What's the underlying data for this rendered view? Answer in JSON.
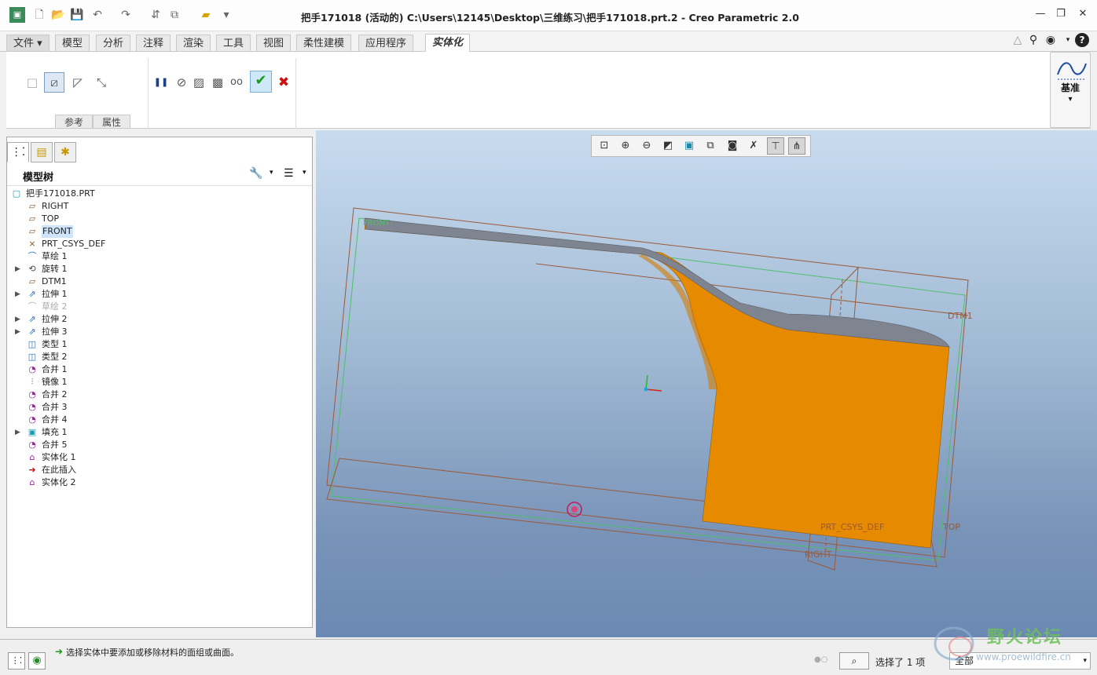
{
  "window": {
    "title": "把手171018 (活动的) C:\\Users\\12145\\Desktop\\三维练习\\把手171018.prt.2 - Creo Parametric 2.0",
    "minimize": "—",
    "restore": "❐",
    "close": "✕"
  },
  "quick_access": {
    "icons": [
      "app-icon",
      "new-file-icon",
      "open-file-icon",
      "save-icon",
      "undo-icon",
      "redo-icon",
      "regenerate-icon",
      "windows-icon",
      "folder-icon",
      "customize-icon"
    ]
  },
  "tabs": [
    "文件 ▾",
    "模型",
    "分析",
    "注释",
    "渲染",
    "工具",
    "视图",
    "柔性建模",
    "应用程序",
    "实体化"
  ],
  "active_tab": "实体化",
  "ribbon": {
    "group_labels": [
      "参考",
      "属性"
    ],
    "datum_label": "基准",
    "datum_arrow": "▾",
    "confirm_symbol": "✔",
    "cancel_symbol": "✖",
    "pause_symbol": "❚❚",
    "glasses_symbol": "oo",
    "help_symbol": "?"
  },
  "model_tree": {
    "title": "模型树",
    "items": [
      {
        "label": "把手171018.PRT",
        "icon": "part-icon",
        "expand": false,
        "indent": 0
      },
      {
        "label": "RIGHT",
        "icon": "plane-icon",
        "expand": false,
        "indent": 1
      },
      {
        "label": "TOP",
        "icon": "plane-icon",
        "expand": false,
        "indent": 1
      },
      {
        "label": "FRONT",
        "icon": "plane-icon",
        "expand": false,
        "indent": 1,
        "highlight": true
      },
      {
        "label": "PRT_CSYS_DEF",
        "icon": "csys-icon",
        "expand": false,
        "indent": 1
      },
      {
        "label": "草绘 1",
        "icon": "sketch-icon",
        "expand": false,
        "indent": 1
      },
      {
        "label": "旋转 1",
        "icon": "revolve-icon",
        "expand": true,
        "indent": 1
      },
      {
        "label": "DTM1",
        "icon": "plane-icon",
        "expand": false,
        "indent": 1
      },
      {
        "label": "拉伸 1",
        "icon": "extrude-icon",
        "expand": true,
        "indent": 1
      },
      {
        "label": "草绘 2",
        "icon": "sketch-icon",
        "expand": false,
        "indent": 1,
        "dim": true
      },
      {
        "label": "拉伸 2",
        "icon": "extrude-icon",
        "expand": true,
        "indent": 1
      },
      {
        "label": "拉伸 3",
        "icon": "extrude-icon",
        "expand": true,
        "indent": 1
      },
      {
        "label": "类型 1",
        "icon": "boundary-icon",
        "expand": false,
        "indent": 1
      },
      {
        "label": "类型 2",
        "icon": "boundary-icon",
        "expand": false,
        "indent": 1
      },
      {
        "label": "合并 1",
        "icon": "merge-icon",
        "expand": false,
        "indent": 1
      },
      {
        "label": "镜像 1",
        "icon": "mirror-icon",
        "expand": false,
        "indent": 1
      },
      {
        "label": "合并 2",
        "icon": "merge-icon",
        "expand": false,
        "indent": 1
      },
      {
        "label": "合并 3",
        "icon": "merge-icon",
        "expand": false,
        "indent": 1
      },
      {
        "label": "合并 4",
        "icon": "merge-icon",
        "expand": false,
        "indent": 1
      },
      {
        "label": "填充 1",
        "icon": "fill-icon",
        "expand": true,
        "indent": 1
      },
      {
        "label": "合并 5",
        "icon": "merge-icon",
        "expand": false,
        "indent": 1
      },
      {
        "label": "实体化 1",
        "icon": "solidify-icon",
        "expand": false,
        "indent": 1
      },
      {
        "label": "在此插入",
        "icon": "insert-here-icon",
        "expand": false,
        "indent": 1
      },
      {
        "label": "实体化 2",
        "icon": "solidify-new-icon",
        "expand": false,
        "indent": 1
      }
    ]
  },
  "viewport": {
    "datum_labels": {
      "front": "FRONT",
      "dtm1": "DTM1",
      "top": "TOP",
      "right": "RIGHT",
      "csys": "PRT_CSYS_DEF"
    },
    "colors": {
      "solid": "#e68a00",
      "top_face": "#7f8590",
      "datum": "#9a5a3a",
      "outline": "#4fbf6b"
    }
  },
  "status": {
    "message": "选择实体中要添加或移除材料的面组或曲面。",
    "selection": "选择了 1 项",
    "filter": "全部"
  },
  "watermark": {
    "text": "野火论坛",
    "url": "www.proewildfire.cn"
  }
}
